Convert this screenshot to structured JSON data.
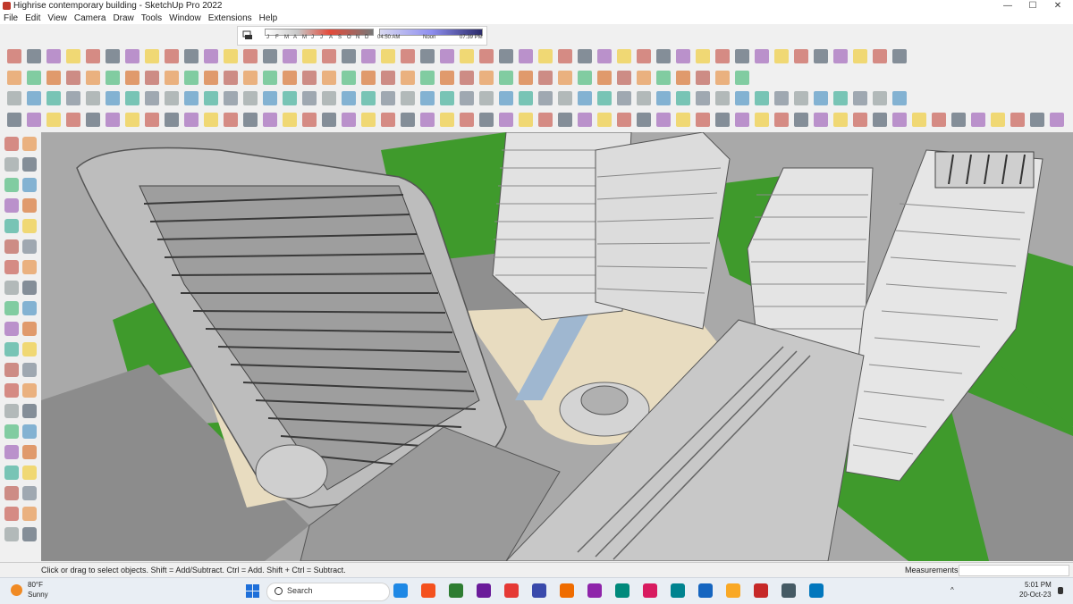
{
  "window": {
    "title": "Highrise contemporary building - SketchUp Pro 2022",
    "controls": {
      "minimize": "—",
      "maximize": "☐",
      "close": "✕"
    }
  },
  "menu": [
    "File",
    "Edit",
    "View",
    "Camera",
    "Draw",
    "Tools",
    "Window",
    "Extensions",
    "Help"
  ],
  "shadow_settings": {
    "months": [
      "J",
      "F",
      "M",
      "A",
      "M",
      "J",
      "J",
      "A",
      "S",
      "O",
      "N",
      "D"
    ],
    "time_start": "04:50 AM",
    "time_mid": "Noon",
    "time_end": "07:39 PM"
  },
  "status": {
    "hint": "Click or drag to select objects. Shift = Add/Subtract. Ctrl = Add. Shift + Ctrl = Subtract.",
    "measurements_label": "Measurements",
    "measurements_value": ""
  },
  "taskbar": {
    "weather_temp": "80°F",
    "weather_desc": "Sunny",
    "search_placeholder": "Search",
    "clock_time": "5:01 PM",
    "clock_date": "20-Oct-23",
    "tray_chevron": "^"
  },
  "colors": {
    "grass": "#3f9a2c",
    "road": "#8a8a8a",
    "paving": "#e8dcc0",
    "water": "#9fb7d0",
    "building": "#d8d8d8"
  }
}
